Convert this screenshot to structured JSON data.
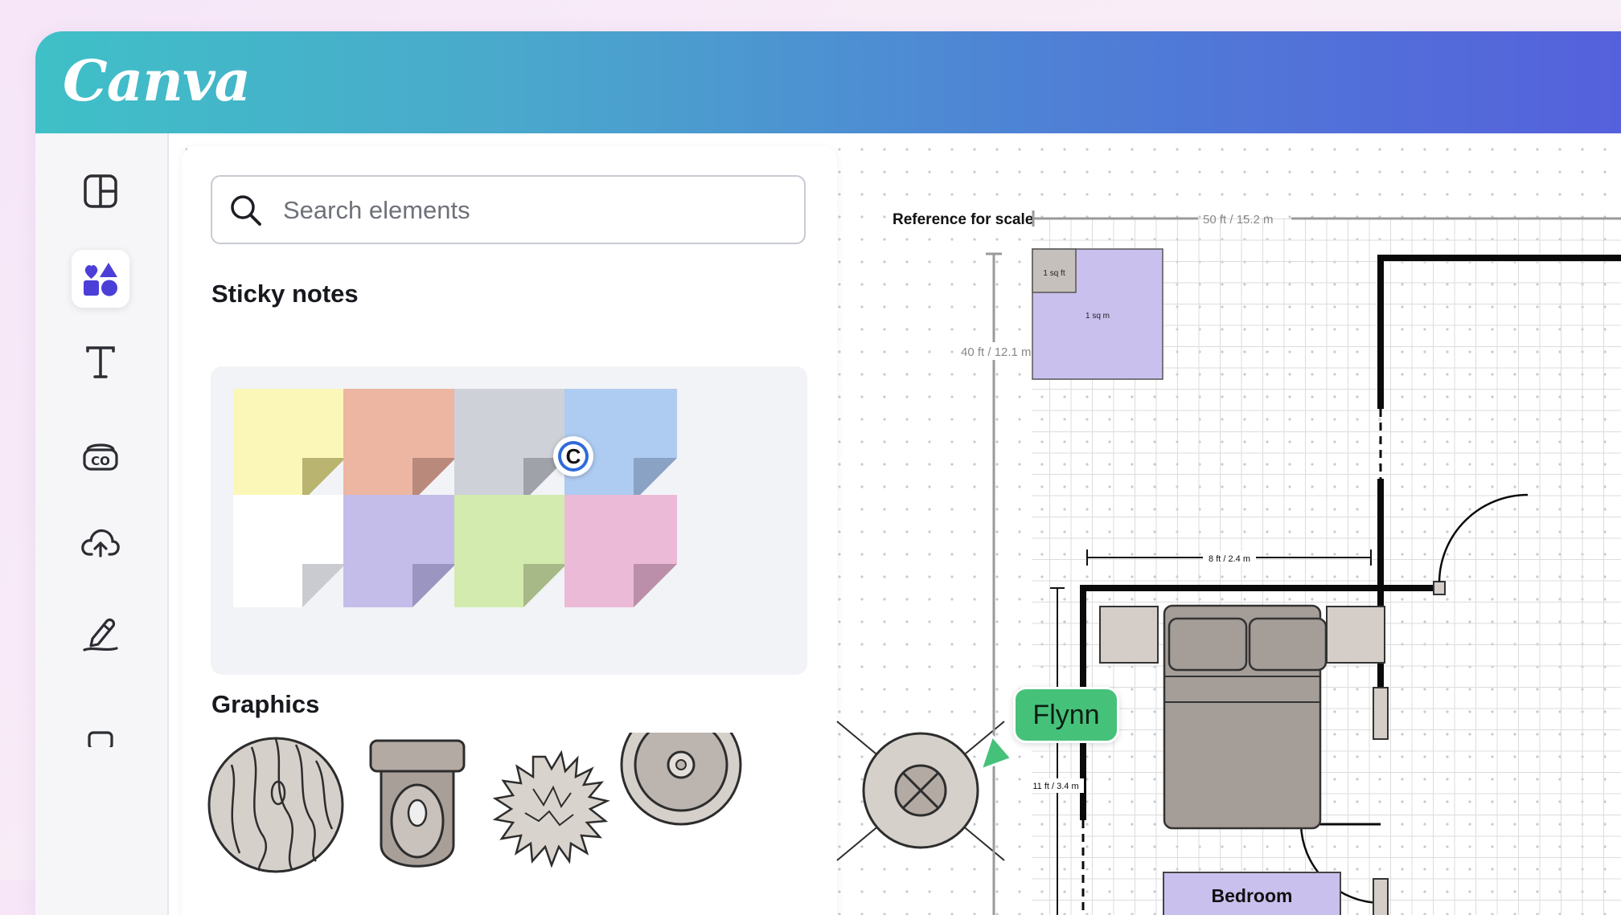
{
  "app": {
    "logo_text": "Canva"
  },
  "rail": {
    "items": [
      {
        "name": "design",
        "icon": "layout-icon"
      },
      {
        "name": "elements",
        "icon": "elements-icon",
        "active": true
      },
      {
        "name": "text",
        "icon": "text-icon"
      },
      {
        "name": "brand",
        "icon": "brand-icon"
      },
      {
        "name": "uploads",
        "icon": "cloud-upload-icon"
      },
      {
        "name": "draw",
        "icon": "pen-draw-icon"
      }
    ]
  },
  "panel": {
    "search_placeholder": "Search elements",
    "sticky_notes_title": "Sticky notes",
    "graphics_title": "Graphics",
    "sticky_notes": [
      {
        "color": "#faf7b8",
        "fold": "#b9b46f"
      },
      {
        "color": "#ecb6a2",
        "fold": "#b9897b"
      },
      {
        "color": "#cfd1d8",
        "fold": "#9fa2a9"
      },
      {
        "color": "#aecbf1",
        "fold": "#8aa2c4"
      },
      {
        "color": "#ffffff",
        "fold": "#c9cbd0"
      },
      {
        "color": "#c4bde9",
        "fold": "#9b95c1"
      },
      {
        "color": "#d3ebae",
        "fold": "#a7b986"
      },
      {
        "color": "#ebbad7",
        "fold": "#bb8fa9"
      }
    ],
    "graphics": [
      "wood-table-graphic",
      "toilet-graphic",
      "shrub-graphic",
      "round-table-graphic",
      "stool-graphic"
    ]
  },
  "floorplan": {
    "reference_label": "Reference for scale",
    "scale_top": "50 ft / 15.2 m",
    "scale_left": "40 ft / 12.1 m",
    "sq_ft": "1 sq ft",
    "sq_m": "1 sq m",
    "dim_width": "8 ft / 2.4 m",
    "dim_height": "11 ft / 3.4 m",
    "room_label": "Bedroom"
  },
  "collaborator": {
    "name": "Flynn",
    "color": "#46c17a"
  },
  "cursor_badge": "C"
}
